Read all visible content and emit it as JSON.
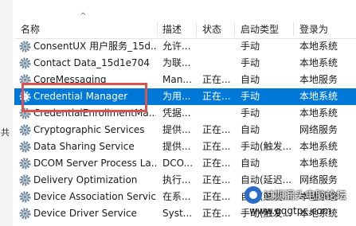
{
  "columns": {
    "name": "名称",
    "description": "描述",
    "status": "状态",
    "startup": "启动类型",
    "logon": "登录为"
  },
  "sort_indicator": "^",
  "edge_text": "共",
  "rows": [
    {
      "name": "ConsentUX 用户服务_15d...",
      "desc": "允许...",
      "status": "",
      "startup": "手动",
      "logon": "本地系统"
    },
    {
      "name": "Contact Data_15d1e704",
      "desc": "为联...",
      "status": "",
      "startup": "手动",
      "logon": "本地系统"
    },
    {
      "name": "CoreMessaging",
      "desc": "Man...",
      "status": "正在...",
      "startup": "自动",
      "logon": "本地服务"
    },
    {
      "name": "Credential Manager",
      "desc": "为用...",
      "status": "正在...",
      "startup": "手动",
      "logon": "本地系统"
    },
    {
      "name": "CredentialEnrollmentMa...",
      "desc": "凭据...",
      "status": "",
      "startup": "手动",
      "logon": "本地系统"
    },
    {
      "name": "Cryptographic Services",
      "desc": "提供...",
      "status": "正在...",
      "startup": "自动",
      "logon": "网络服务"
    },
    {
      "name": "Data Sharing Service",
      "desc": "提供...",
      "status": "正在...",
      "startup": "手动(触发...",
      "logon": "本地系统"
    },
    {
      "name": "DCOM Server Process La...",
      "desc": "DCO...",
      "status": "正在...",
      "startup": "自动",
      "logon": "本地系统"
    },
    {
      "name": "Delivery Optimization",
      "desc": "执行...",
      "status": "正在...",
      "startup": "自动(延迟...",
      "logon": "网络服务"
    },
    {
      "name": "Device Association Service",
      "desc": "在系...",
      "status": "正在...",
      "startup": "自动(触发...",
      "logon": "本地系统"
    },
    {
      "name": "Device Driver Service",
      "desc": "Syst...",
      "status": "正在...",
      "startup": "手动(触发...",
      "logon": "本地系统"
    }
  ],
  "selected_index": 3,
  "watermark": {
    "title": "过期漏头电脑论坛",
    "url": "www.gqgtpc.com"
  },
  "colors": {
    "selection": "#0078d7",
    "highlight_box": "#d9534f"
  }
}
